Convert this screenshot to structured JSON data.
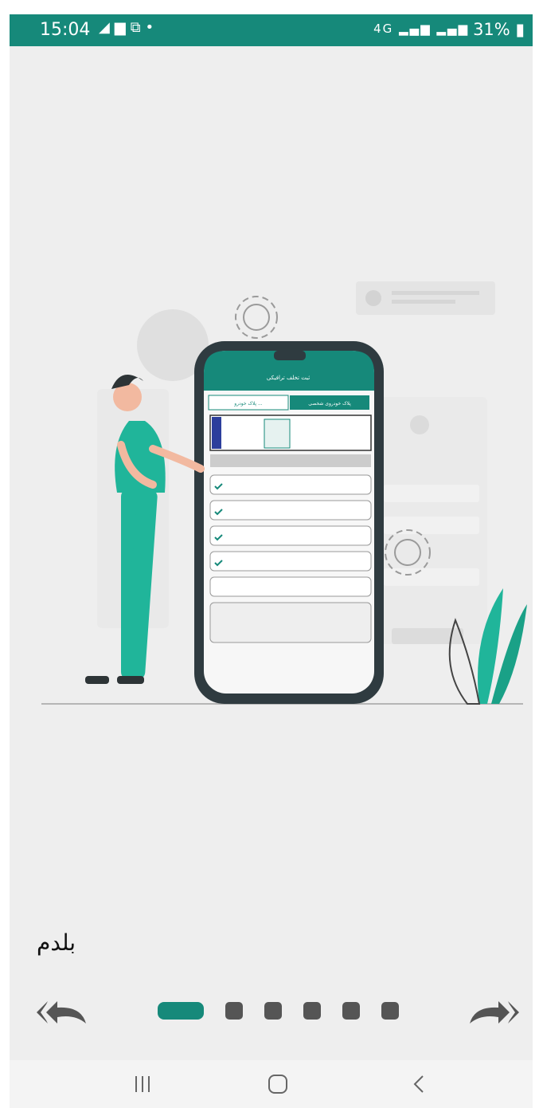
{
  "status_bar": {
    "time": "15:04",
    "left_icons": [
      "signal-icon",
      "message-icon",
      "translate-icon",
      "dot-icon"
    ],
    "network": "4G",
    "battery_text": "31%"
  },
  "illustration": {
    "mock_app_title": "ثبت تخلف ترافیکی",
    "mock_tab_1": "پلاک خودروی شخصی",
    "mock_tab_2": "پلاک خودرو ..."
  },
  "onboarding": {
    "caption": "بلدم",
    "page_count": 6,
    "current_page": 1
  },
  "nav_bar": {
    "recent_icon": "recent-apps-icon",
    "home_icon": "home-icon",
    "back_icon": "back-icon"
  },
  "colors": {
    "accent": "#16897a",
    "background": "#eeeeee",
    "dot_inactive": "#555555",
    "plant": "#20b59a"
  }
}
